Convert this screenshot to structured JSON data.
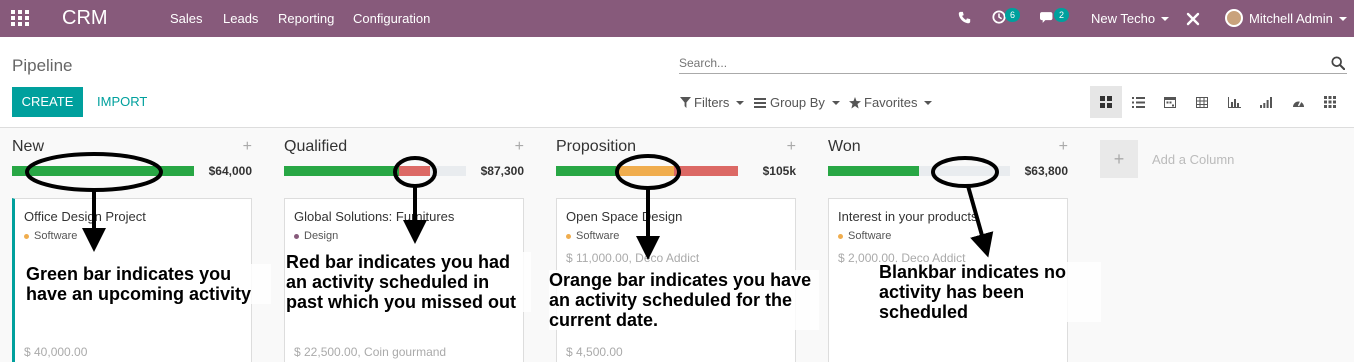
{
  "navbar": {
    "brand": "CRM",
    "menu": [
      "Sales",
      "Leads",
      "Reporting",
      "Configuration"
    ],
    "activity_badge": "6",
    "message_badge": "2",
    "company": "New Techo",
    "user": "Mitchell Admin"
  },
  "control_panel": {
    "breadcrumb": "Pipeline",
    "search_placeholder": "Search...",
    "create_label": "CREATE",
    "import_label": "IMPORT",
    "filters_label": "Filters",
    "groupby_label": "Group By",
    "favorites_label": "Favorites",
    "views": [
      "kanban",
      "list",
      "calendar",
      "pivot",
      "graph",
      "cohort",
      "dashboard",
      "activity"
    ]
  },
  "columns": [
    {
      "title": "New",
      "total": "$64,000",
      "progress": {
        "green": 1.0,
        "red": 0,
        "orange": 0
      },
      "card": {
        "title": "Office Design Project",
        "tag": "Software",
        "tag_color": "#f0ad4e",
        "amount": "$ 40,000.00"
      }
    },
    {
      "title": "Qualified",
      "total": "$87,300",
      "progress": {
        "green": 0.63,
        "red": 0.17,
        "orange": 0
      },
      "card": {
        "title": "Global Solutions: Furnitures",
        "tag": "Design",
        "tag_color": "#875a7b",
        "amount": "$ 22,500.00, Coin gourmand"
      }
    },
    {
      "title": "Proposition",
      "total": "$105k",
      "progress": {
        "green": 0.33,
        "orange": 0.32,
        "red": 0.35
      },
      "card": {
        "title": "Open Space Design",
        "tag": "Software",
        "tag_color": "#f0ad4e",
        "amount": "$ 11,000.00, Deco Addict",
        "amount2": "$ 4,500.00"
      }
    },
    {
      "title": "Won",
      "total": "$63,800",
      "progress": {
        "green": 0.5,
        "red": 0,
        "orange": 0
      },
      "card": {
        "title": "Interest in your products",
        "tag": "Software",
        "tag_color": "#f0ad4e",
        "amount": "$ 2,000.00, Deco Addict"
      }
    }
  ],
  "add_column_label": "Add a Column",
  "annotations": [
    "Green bar indicates you have an upcoming activity",
    "Red bar indicates you had an activity scheduled in past which you missed out",
    "Orange bar indicates you have an activity scheduled for the current date.",
    "Blankbar indicates no activity has been scheduled"
  ],
  "colors": {
    "navbar": "#875a7b",
    "primary": "#00a09d",
    "green": "#28a745",
    "red": "#dc6965",
    "orange": "#f0ad4e"
  }
}
